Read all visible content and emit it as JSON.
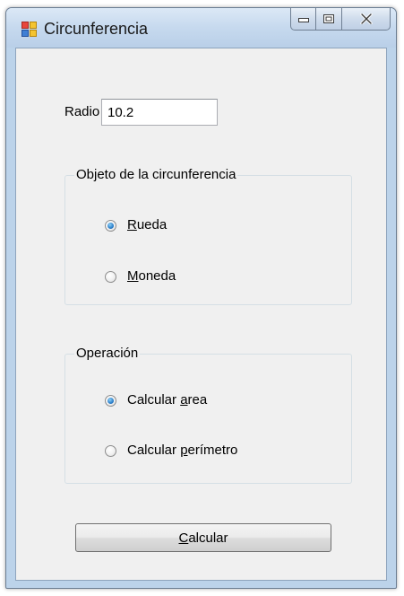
{
  "window": {
    "title": "Circunferencia"
  },
  "form": {
    "radio_label": "Radio",
    "radio_value": "10.2"
  },
  "object_group": {
    "legend": "Objeto de la circunferencia",
    "options": [
      {
        "pre": "",
        "accel": "R",
        "post": "ueda",
        "checked": true
      },
      {
        "pre": "",
        "accel": "M",
        "post": "oneda",
        "checked": false
      }
    ]
  },
  "operation_group": {
    "legend": "Operación",
    "options": [
      {
        "pre": "Calcular ",
        "accel": "a",
        "post": "rea",
        "checked": true
      },
      {
        "pre": "Calcular ",
        "accel": "p",
        "post": "erímetro",
        "checked": false
      }
    ]
  },
  "action": {
    "accel": "C",
    "post": "alcular"
  },
  "icons": {
    "app": "form-app-icon",
    "minimize": "minimize-icon",
    "maximize": "maximize-icon",
    "close": "close-icon"
  },
  "colors": {
    "accent": "#2b7ec9",
    "titlebar": "#c6d9ee",
    "client_bg": "#f0f0f0"
  }
}
